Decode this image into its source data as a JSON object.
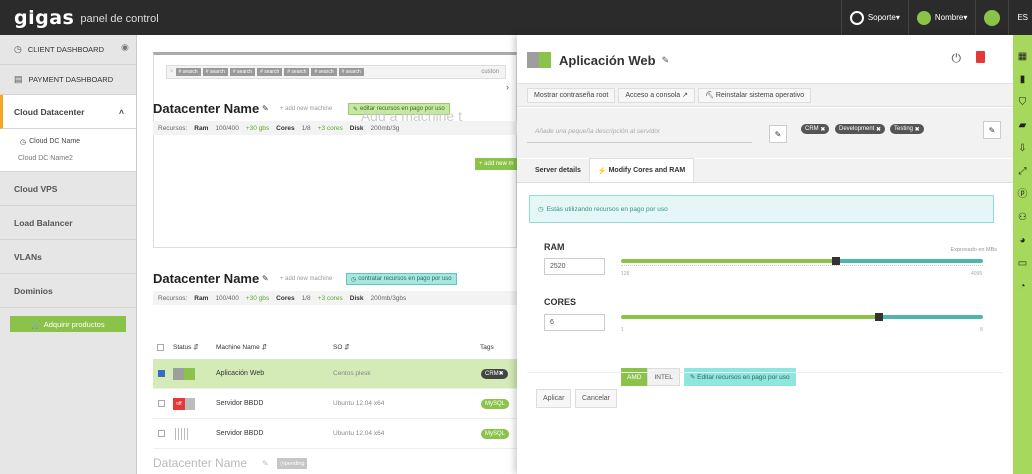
{
  "topbar": {
    "logo": "gigas",
    "subtitle": "panel de control",
    "support": "Soporte",
    "name": "Nombre",
    "lang": "ES"
  },
  "sidebar": {
    "client_dashboard": "CLIENT DASHBOARD",
    "payment_dashboard": "PAYMENT DASHBOARD",
    "cloud_datacenter": "Cloud Datacenter",
    "dc1": "Cloud DC Name",
    "dc2": "Cloud DC Name2",
    "cloud_vps": "Cloud VPS",
    "load_balancer": "Load Balancer",
    "vlans": "VLANs",
    "dominios": "Dominios",
    "buy": "Adquirir productos"
  },
  "search": {
    "chips": [
      "# search",
      "# search",
      "# search",
      "# search",
      "# search",
      "# search",
      "# search"
    ],
    "custom": "custon"
  },
  "dc_top": {
    "title": "Datacenter Name",
    "add": "add new machine",
    "pill": "editar recursos en pago por uso",
    "res": [
      "Recursos:",
      "Ram",
      "100/400",
      "+30 gbs",
      "Cores",
      "1/8",
      "+3 cores",
      "Disk",
      "200mb/3g"
    ],
    "add_machine_text": "Add a machine t",
    "add_machine_btn": "+ add new m"
  },
  "dc_mid": {
    "title": "Datacenter Name",
    "add": "add new machine",
    "pill": "contratar recursos en pago por uso",
    "res": [
      "Recursos:",
      "Ram",
      "100/400",
      "+30 gbs",
      "Cores",
      "1/8",
      "+3 cores",
      "Disk",
      "200mb/3gbs"
    ]
  },
  "table": {
    "headers": [
      "Status",
      "Machine Name",
      "SO",
      "Tags"
    ],
    "rows": [
      {
        "name": "Aplicación Web",
        "so": "Centos plesk",
        "tag": "CRM"
      },
      {
        "name": "Servidor BBDD",
        "so": "Ubuntu 12.04 x64",
        "tag": "MySQL"
      },
      {
        "name": "Servidor BBDD",
        "so": "Ubuntu 12.04 x64",
        "tag": "MySQL"
      }
    ],
    "off_label": "off"
  },
  "dc_pending": {
    "title": "Datacenter Name",
    "pill": "pending"
  },
  "detail": {
    "title": "Aplicación Web",
    "actions": [
      "Mostrar contraseña root",
      "Acceso a consola",
      "Reinstalar sistema operativo"
    ],
    "desc_placeholder": "Añade una pequeña descripción al servidor",
    "tags": [
      "CRM",
      "Development",
      "Testing"
    ],
    "tabs": [
      "Server details",
      "Modify Cores and RAM"
    ],
    "info": "Estás utilizando recursos en pago por uso",
    "ram_label": "RAM",
    "ram_value": "2520",
    "ram_note": "Expresado en MBs",
    "ram_min": "128",
    "ram_max": "4096",
    "ram_level": 0.595,
    "cores_label": "CORES",
    "cores_value": "6",
    "cores_min": "1",
    "cores_max": "8",
    "cores_level": 0.714,
    "amd": "AMD",
    "intel": "INTEL",
    "pay": "Editar recursos en pago por uso",
    "apply": "Aplicar",
    "cancel": "Cancelar"
  },
  "colors": {
    "green": "#8bc34a",
    "teal": "#4db6ac",
    "dark": "#2b2b2b"
  }
}
